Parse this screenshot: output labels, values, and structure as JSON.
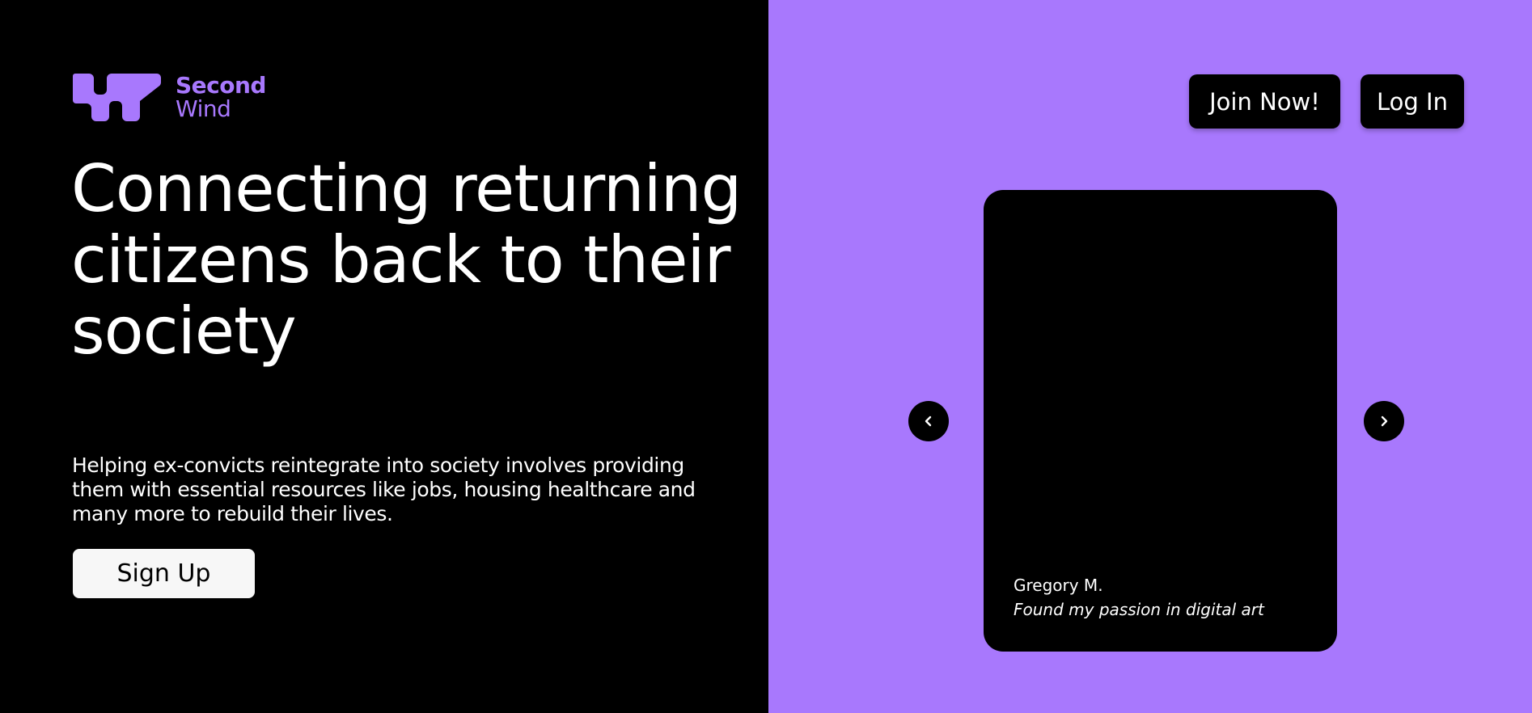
{
  "brand": {
    "name_line1": "Second",
    "name_line2": "Wind",
    "accent_color": "#a878fd",
    "logo_icon": "wave-logo-icon"
  },
  "hero": {
    "headline": "Connecting returning citizens back to their society",
    "description": "Helping ex-convicts reintegrate into society involves providing them with essential resources like jobs, housing healthcare and many more to rebuild their lives.",
    "signup_label": "Sign Up"
  },
  "nav": {
    "join_label": "Join Now!",
    "login_label": "Log In"
  },
  "carousel": {
    "prev_icon": "chevron-left-icon",
    "next_icon": "chevron-right-icon",
    "current": {
      "name": "Gregory M.",
      "quote": "Found my passion in digital art"
    }
  },
  "colors": {
    "left_background": "#000000",
    "right_background": "#a878fd",
    "button_dark": "#000000",
    "button_light": "#f7f7f7"
  }
}
